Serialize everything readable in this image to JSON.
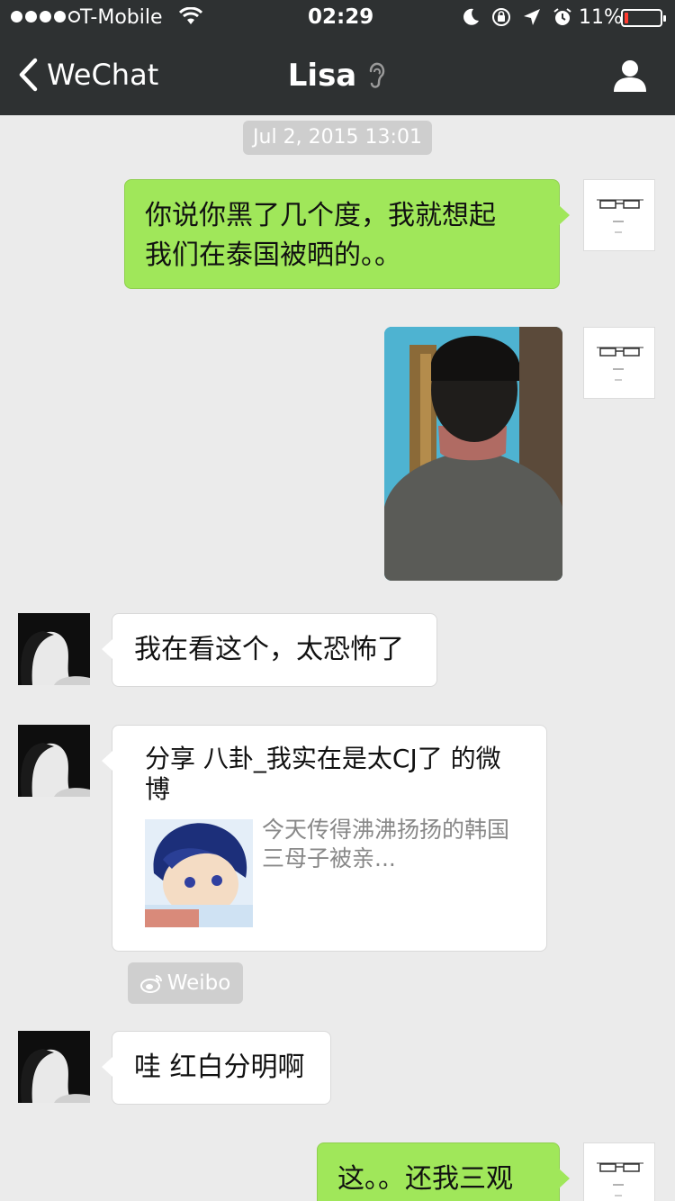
{
  "status_bar": {
    "carrier": "T-Mobile",
    "time": "02:29",
    "battery": "11%",
    "battery_level": 0.11,
    "signal_bars": 4,
    "icons": [
      "wifi-icon",
      "moon-icon",
      "rotation-lock-icon",
      "location-arrow-icon",
      "alarm-icon",
      "battery-icon"
    ]
  },
  "nav": {
    "back_label": "WeChat",
    "title": "Lisa",
    "icons": [
      "chevron-left-icon",
      "earpiece-icon",
      "profile-icon"
    ]
  },
  "chat": {
    "timestamp": "Jul 2, 2015 13:01",
    "messages": [
      {
        "sender": "me",
        "type": "text",
        "lines": [
          "你说你黑了几个度，我就想起",
          "我们在泰国被晒的。。"
        ]
      },
      {
        "sender": "me",
        "type": "image"
      },
      {
        "sender": "Lisa",
        "type": "text",
        "lines": [
          "我在看这个，太恐怖了"
        ]
      },
      {
        "sender": "Lisa",
        "type": "share",
        "title_lines": [
          "分享 八卦_我实在是太CJ了 的微",
          "博"
        ],
        "desc_lines": [
          "今天传得沸沸扬扬的韩国",
          "三母子被亲..."
        ],
        "source": "Weibo"
      },
      {
        "sender": "Lisa",
        "type": "text",
        "lines": [
          "哇 红白分明啊"
        ]
      },
      {
        "sender": "me",
        "type": "text",
        "lines": [
          "这。。还我三观"
        ]
      }
    ]
  },
  "colors": {
    "nav_bg": "#2e3132",
    "chat_bg": "#ebebeb",
    "bubble_me": "#a0e75a",
    "bubble_lisa": "#ffffff",
    "timestamp_bg": "#cecece"
  }
}
